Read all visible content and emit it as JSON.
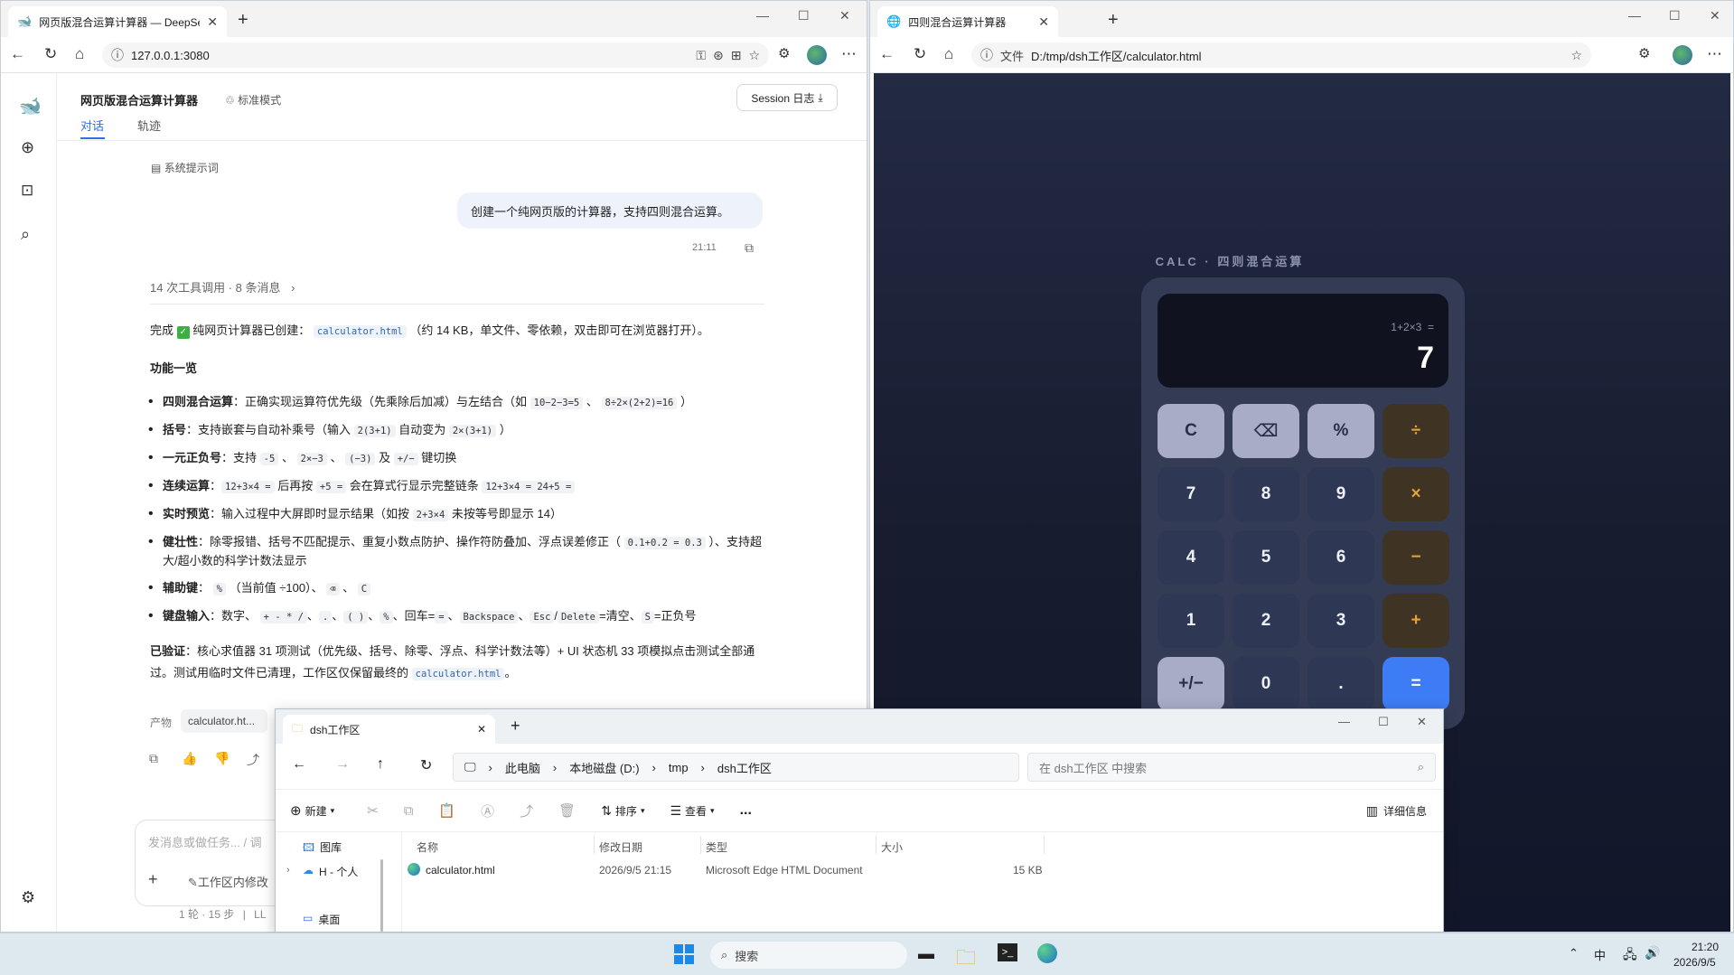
{
  "left_browser": {
    "tab_title": "网页版混合运算计算器 — DeepSe",
    "url": "127.0.0.1:3080",
    "app": {
      "title": "网页版混合运算计算器",
      "mode": "标准模式",
      "session_button": "Session 日志",
      "tabs": [
        "对话",
        "轨迹"
      ],
      "system_prompt": "系统提示词",
      "user_message": "创建一个纯网页版的计算器，支持四则混合运算。",
      "message_time": "21:11",
      "tool_summary": "14 次工具调用 · 8 条消息",
      "reply": {
        "done_prefix": "完成",
        "done_text": "纯网页计算器已创建：",
        "file_code": "calculator.html",
        "done_suffix": "（约 14 KB，单文件、零依赖，双击即可在浏览器打开）。",
        "features_heading": "功能一览",
        "b1_label": "四则混合运算",
        "b1_text": "：正确实现运算符优先级（先乘除后加减）与左结合（如",
        "b1_code1": "10−2−3=5",
        "b1_sep": "、",
        "b1_code2": "8÷2×(2+2)=16",
        "b1_end": "）",
        "b2_label": "括号",
        "b2_text": "：支持嵌套与自动补乘号（输入",
        "b2_code1": "2(3+1)",
        "b2_mid": "自动变为",
        "b2_code2": "2×(3+1)",
        "b2_end": "）",
        "b3_label": "一元正负号",
        "b3_text": "：支持",
        "b3_code1": "-5",
        "b3_sep1": "、",
        "b3_code2": "2×−3",
        "b3_sep2": "、",
        "b3_code3": "(−3)",
        "b3_mid": "及",
        "b3_code4": "+/−",
        "b3_end": "键切换",
        "b4_label": "连续运算",
        "b4_text": "：",
        "b4_code1": "12+3×4 =",
        "b4_mid1": "后再按",
        "b4_code2": "+5 =",
        "b4_mid2": "会在算式行显示完整链条",
        "b4_code3": "12+3×4 = 24+5 =",
        "b5_label": "实时预览",
        "b5_text": "：输入过程中大屏即时显示结果（如按",
        "b5_code1": "2+3×4",
        "b5_end": "未按等号即显示 14）",
        "b6_label": "健壮性",
        "b6_text": "：除零报错、括号不匹配提示、重复小数点防护、操作符防叠加、浮点误差修正（",
        "b6_code1": "0.1+0.2 = 0.3",
        "b6_end": "）、支持超大/超小数的科学计数法显示",
        "b7_label": "辅助键",
        "b7_text": "：",
        "b7_code1": "%",
        "b7_mid": "（当前值 ÷100）、",
        "b7_code2": "⌫",
        "b7_sep": "、",
        "b7_code3": "C",
        "b8_label": "键盘输入",
        "b8_text": "：数字、",
        "b8_code1": "+ - * /",
        "b8_sep1": "、",
        "b8_code2": ".",
        "b8_sep2": "、",
        "b8_code3": "( )",
        "b8_sep3": "、",
        "b8_code4": "%",
        "b8_mid1": "、回车=",
        "b8_code5": "=",
        "b8_sep4": "、",
        "b8_code6": "Backspace",
        "b8_sep5": "、",
        "b8_code7": "Esc",
        "b8_slash": "/",
        "b8_code8": "Delete",
        "b8_mid2": "=清空、",
        "b8_code9": "S",
        "b8_end": "=正负号",
        "verified_label": "已验证",
        "verified_text": "：核心求值器 31 项测试（优先级、括号、除零、浮点、科学计数法等）+ UI 状态机 33 项模拟点击测试全部通过。测试用临时文件已清理，工作区仅保留最终的",
        "verified_code": "calculator.html",
        "verified_end": "。"
      },
      "artifact_label": "产物",
      "artifact_chip": "calculator.ht...",
      "input_placeholder": "发消息或做任务... / 调",
      "workspace_toggle": "工作区内修改",
      "footer_stats": "1 轮 · 15 步",
      "footer_sep": "|",
      "footer_tail": "LL"
    }
  },
  "right_browser": {
    "tab_title": "四则混合运算计算器",
    "url_label": "文件",
    "url": "D:/tmp/dsh工作区/calculator.html",
    "calculator": {
      "heading": "CALC · 四则混合运算",
      "expression": "1+2×3  =",
      "result": "7",
      "keys": [
        "C",
        "⌫",
        "%",
        "÷",
        "7",
        "8",
        "9",
        "×",
        "4",
        "5",
        "6",
        "−",
        "1",
        "2",
        "3",
        "+",
        "+/−",
        "0",
        ".",
        "="
      ]
    }
  },
  "explorer": {
    "tab_title": "dsh工作区",
    "breadcrumb": [
      "此电脑",
      "本地磁盘 (D:)",
      "tmp",
      "dsh工作区"
    ],
    "search_placeholder": "在 dsh工作区 中搜索",
    "toolbar": {
      "new": "新建",
      "sort": "排序",
      "view": "查看",
      "more": "...",
      "details": "详细信息"
    },
    "sidebar": [
      "图库",
      "H - 个人",
      "桌面"
    ],
    "columns": [
      "名称",
      "修改日期",
      "类型",
      "大小"
    ],
    "files": [
      {
        "name": "calculator.html",
        "modified": "2026/9/5 21:15",
        "type": "Microsoft Edge HTML Document",
        "size": "15 KB"
      }
    ]
  },
  "taskbar": {
    "search": "搜索",
    "ime": "中",
    "time": "21:20",
    "date": "2026/9/5"
  }
}
